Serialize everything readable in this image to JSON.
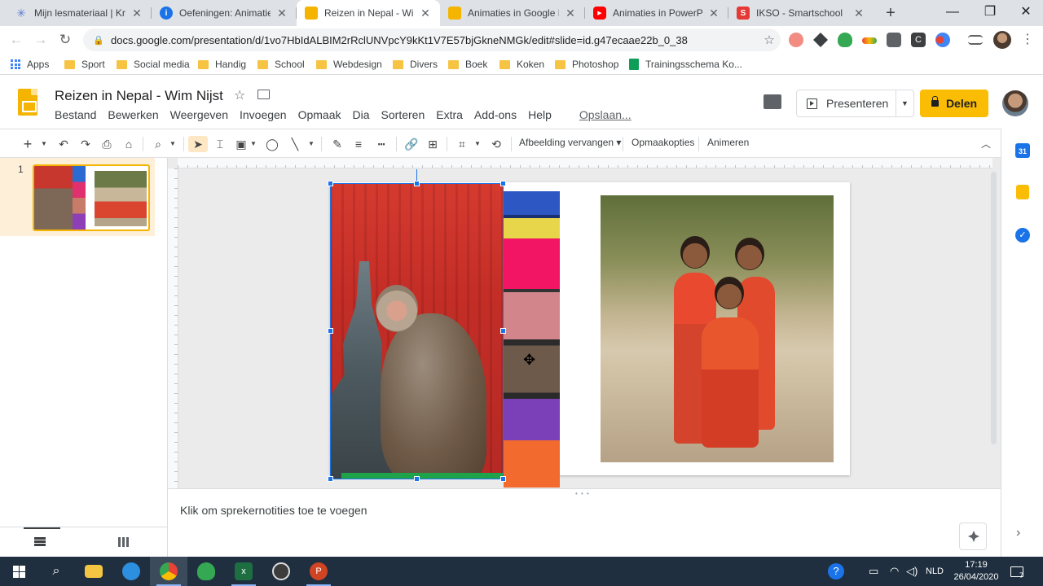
{
  "tabs": [
    {
      "title": "Mijn lesmateriaal | Knoo",
      "favicon": "snowflake-icon",
      "color": "#5b7bd5"
    },
    {
      "title": "Oefeningen: Animaties",
      "favicon": "info-icon",
      "color": "#1a73e8"
    },
    {
      "title": "Reizen in Nepal - Wim",
      "favicon": "slides-icon",
      "color": "#f4b400"
    },
    {
      "title": "Animaties in Google Pr",
      "favicon": "slides-icon",
      "color": "#f4b400"
    },
    {
      "title": "Animaties in PowerPoin",
      "favicon": "youtube-icon",
      "color": "#ff0000"
    },
    {
      "title": "IKSO - Smartschool",
      "favicon": "smartschool-icon",
      "color": "#e53935"
    }
  ],
  "omnibox": {
    "url": "docs.google.com/presentation/d/1vo7HbIdALBIM2rRclUNVpcY9kKt1V7E57bjGkneNMGk/edit#slide=id.g47ecaae22b_0_38"
  },
  "bookmarks": {
    "apps": "Apps",
    "items": [
      "Sport",
      "Social media",
      "Handig",
      "School",
      "Webdesign",
      "Divers",
      "Boek",
      "Koken",
      "Photoshop"
    ],
    "sheet": "Trainingsschema Ko..."
  },
  "doc": {
    "title": "Reizen in Nepal - Wim Nijst"
  },
  "menu": [
    "Bestand",
    "Bewerken",
    "Weergeven",
    "Invoegen",
    "Opmaak",
    "Dia",
    "Sorteren",
    "Extra",
    "Add-ons",
    "Help"
  ],
  "menu_save": "Opslaan...",
  "header": {
    "present": "Presenteren",
    "share": "Delen"
  },
  "toolbar": {
    "replace_image": "Afbeelding vervangen",
    "format_options": "Opmaakopties",
    "animate": "Animeren"
  },
  "filmstrip": {
    "slide_number": "1"
  },
  "notes": {
    "placeholder": "Klik om sprekernotities toe te voegen"
  },
  "sidepanel": {
    "calendar_day": "31"
  },
  "clock": {
    "time": "17:19",
    "date": "26/04/2020"
  },
  "tray": {
    "language": "NLD",
    "notifications": "7"
  },
  "colors": {
    "accent": "#fbbc04",
    "selection": "#1a73e8"
  }
}
